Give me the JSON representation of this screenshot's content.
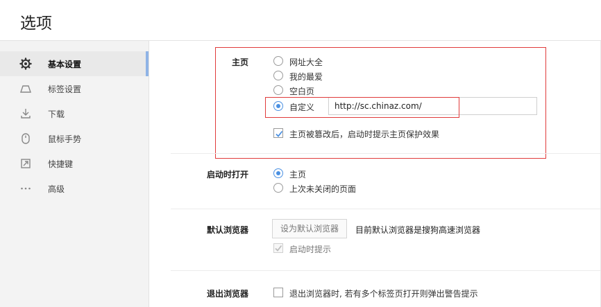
{
  "header": {
    "title": "选项"
  },
  "sidebar": {
    "items": [
      {
        "label": "基本设置",
        "icon": "gear-icon",
        "active": true
      },
      {
        "label": "标签设置",
        "icon": "tab-icon"
      },
      {
        "label": "下载",
        "icon": "download-icon"
      },
      {
        "label": "鼠标手势",
        "icon": "mouse-icon"
      },
      {
        "label": "快捷键",
        "icon": "shortcut-icon"
      },
      {
        "label": "高级",
        "icon": "more-icon"
      }
    ]
  },
  "homepage": {
    "label": "主页",
    "options": [
      "网址大全",
      "我的最爱",
      "空白页",
      "自定义"
    ],
    "selected": "自定义",
    "custom_url": "http://sc.chinaz.com/",
    "protect_checkbox": {
      "label": "主页被篡改后，启动时提示主页保护效果",
      "checked": true
    }
  },
  "startup": {
    "label": "启动时打开",
    "options": [
      "主页",
      "上次未关闭的页面"
    ],
    "selected": "主页"
  },
  "default_browser": {
    "label": "默认浏览器",
    "button_label": "设为默认浏览器",
    "status": "目前默认浏览器是搜狗高速浏览器",
    "prompt_checkbox": {
      "label": "启动时提示",
      "checked": true,
      "disabled": true
    }
  },
  "exit_browser": {
    "label": "退出浏览器",
    "checkbox": {
      "label": "退出浏览器时, 若有多个标签页打开则弹出警告提示",
      "checked": false
    }
  },
  "colors": {
    "accent": "#4a90e2",
    "highlight": "#e03a3a",
    "sidebar_bg": "#f3f3f3"
  }
}
